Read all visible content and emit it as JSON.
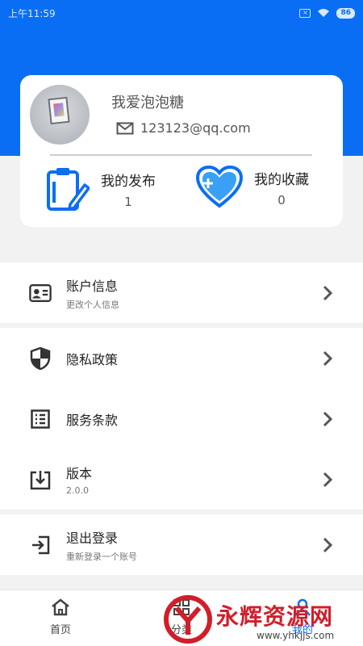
{
  "status_bar": {
    "time": "上午11:59",
    "battery": "86"
  },
  "profile": {
    "nickname": "我爱泡泡糖",
    "email": "123123@qq.com"
  },
  "stats": {
    "publish": {
      "label": "我的发布",
      "value": "1"
    },
    "favorites": {
      "label": "我的收藏",
      "value": "0"
    }
  },
  "menu": {
    "account": {
      "title": "账户信息",
      "subtitle": "更改个人信息"
    },
    "privacy": {
      "title": "隐私政策"
    },
    "terms": {
      "title": "服务条款"
    },
    "version": {
      "title": "版本",
      "subtitle": "2.0.0"
    },
    "logout": {
      "title": "退出登录",
      "subtitle": "重新登录一个账号"
    }
  },
  "nav": {
    "home": "首页",
    "middle": "分类",
    "mine": "我的"
  },
  "watermark": {
    "name": "永辉资源网",
    "url": "www.yhkjjs.com"
  },
  "colors": {
    "primary": "#0a6ef5",
    "watermark_red": "#d11e2a"
  }
}
